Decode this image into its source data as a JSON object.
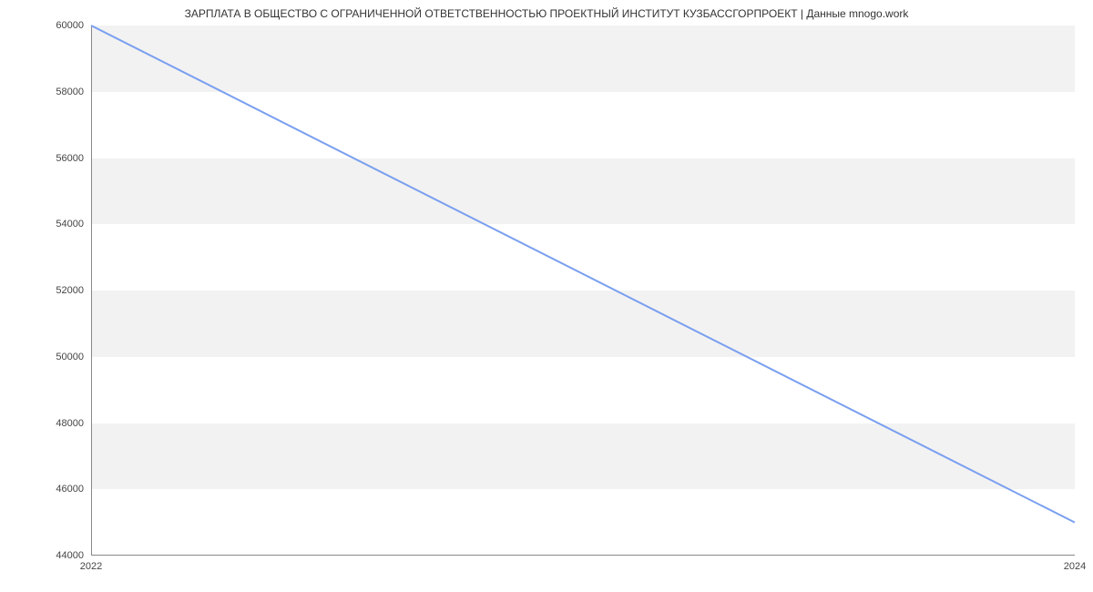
{
  "chart_data": {
    "type": "line",
    "title": "ЗАРПЛАТА В ОБЩЕСТВО С ОГРАНИЧЕННОЙ  ОТВЕТСТВЕННОСТЬЮ ПРОЕКТНЫЙ ИНСТИТУТ КУЗБАССГОРПРОЕКТ | Данные mnogo.work",
    "x": [
      2022,
      2024
    ],
    "values": [
      60000,
      45000
    ],
    "xlabel": "",
    "ylabel": "",
    "x_ticks": [
      2022,
      2024
    ],
    "y_ticks": [
      44000,
      46000,
      48000,
      50000,
      52000,
      54000,
      56000,
      58000,
      60000
    ],
    "xlim": [
      2022,
      2024
    ],
    "ylim": [
      44000,
      60000
    ],
    "line_color": "#7a9ff0"
  }
}
